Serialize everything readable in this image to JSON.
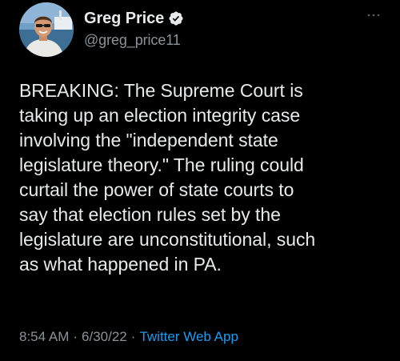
{
  "author": {
    "display_name": "Greg Price",
    "handle": "@greg_price11",
    "verified": true,
    "avatar": "profile-photo-man-in-sunglasses-on-boat"
  },
  "tweet": {
    "text": "BREAKING: The Supreme Court is\ntaking up an election integrity case\ninvolving the \"independent state\nlegislature theory.\" The ruling could\ncurtail the power of state courts to\nsay that election rules set by the\nlegislature are unconstitutional, such\nas what happened in PA."
  },
  "meta": {
    "time": "8:54 AM",
    "separator": "·",
    "date": "6/30/22",
    "source": "Twitter Web App"
  },
  "icons": {
    "verified": "verified-badge-icon",
    "more": "more-options-icon"
  },
  "colors": {
    "background": "#000000",
    "text": "#e7e9ea",
    "secondary": "#8b9298",
    "link": "#1d9bf0"
  }
}
